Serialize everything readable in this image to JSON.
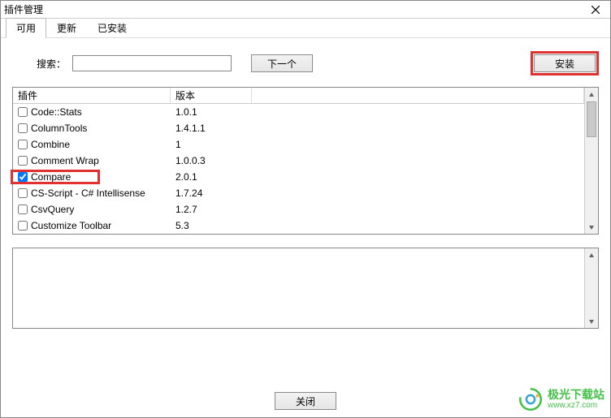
{
  "window": {
    "title": "插件管理"
  },
  "tabs": {
    "available": "可用",
    "update": "更新",
    "installed": "已安装",
    "active": "available"
  },
  "search": {
    "label": "搜索：",
    "value": "",
    "next": "下一个"
  },
  "install": {
    "label": "安装"
  },
  "table": {
    "headers": {
      "plugin": "插件",
      "version": "版本"
    },
    "rows": [
      {
        "name": "Code::Stats",
        "version": "1.0.1",
        "checked": false
      },
      {
        "name": "ColumnTools",
        "version": "1.4.1.1",
        "checked": false
      },
      {
        "name": "Combine",
        "version": "1",
        "checked": false
      },
      {
        "name": "Comment Wrap",
        "version": "1.0.0.3",
        "checked": false
      },
      {
        "name": "Compare",
        "version": "2.0.1",
        "checked": true,
        "highlight": true
      },
      {
        "name": "CS-Script - C# Intellisense",
        "version": "1.7.24",
        "checked": false
      },
      {
        "name": "CsvQuery",
        "version": "1.2.7",
        "checked": false
      },
      {
        "name": "Customize Toolbar",
        "version": "5.3",
        "checked": false
      }
    ]
  },
  "footer": {
    "close": "关闭"
  },
  "watermark": {
    "line1": "极光下载站",
    "line2": "www.xz7.com"
  }
}
